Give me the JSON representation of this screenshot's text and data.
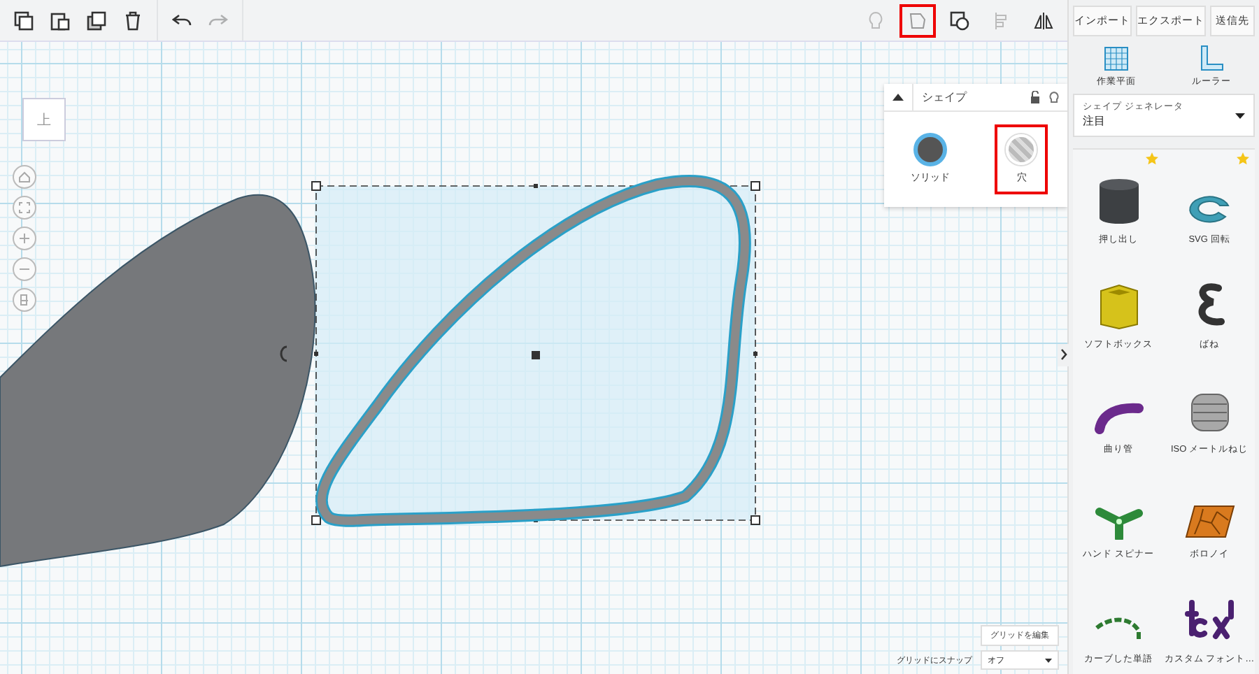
{
  "toolbar": {
    "left_tools": [
      {
        "kind": "copy"
      },
      {
        "kind": "paste"
      },
      {
        "kind": "duplicate"
      },
      {
        "kind": "delete"
      },
      {
        "kind": "undo",
        "disabled": false
      },
      {
        "kind": "redo",
        "disabled": true
      }
    ],
    "right_tools": [
      {
        "kind": "bulb",
        "highlighted": false
      },
      {
        "kind": "shape",
        "highlighted": true
      },
      {
        "kind": "group",
        "highlighted": false
      },
      {
        "kind": "align",
        "highlighted": false
      },
      {
        "kind": "mirror",
        "highlighted": false
      }
    ]
  },
  "view_cube": {
    "label": "上"
  },
  "shape_panel": {
    "title": "シェイプ",
    "options": [
      {
        "kind": "solid",
        "label": "ソリッド",
        "selected": true,
        "highlighted": false
      },
      {
        "kind": "hole",
        "label": "穴",
        "selected": false,
        "highlighted": true
      }
    ]
  },
  "header_buttons": [
    "インポート",
    "エクスポート",
    "送信先"
  ],
  "tools": [
    {
      "kind": "workplane",
      "label": "作業平面"
    },
    {
      "kind": "ruler",
      "label": "ルーラー"
    }
  ],
  "generator": {
    "label": "シェイプ ジェネレータ",
    "value": "注目"
  },
  "shapes": [
    {
      "kind": "extrude",
      "label": "押し出し",
      "starred": true
    },
    {
      "kind": "svg",
      "label": "SVG 回転",
      "starred": true
    },
    {
      "kind": "box",
      "label": "ソフトボックス",
      "starred": false
    },
    {
      "kind": "spring",
      "label": "ばね",
      "starred": false
    },
    {
      "kind": "pipe",
      "label": "曲り管",
      "starred": false
    },
    {
      "kind": "screw",
      "label": "ISO メートルねじ",
      "starred": false
    },
    {
      "kind": "spinner",
      "label": "ハンド スピナー",
      "starred": false
    },
    {
      "kind": "voronoi",
      "label": "ボロノイ",
      "starred": false
    },
    {
      "kind": "curved",
      "label": "カーブした単語",
      "starred": false
    },
    {
      "kind": "font",
      "label": "カスタム フォント…",
      "starred": false
    }
  ],
  "grid": {
    "edit_label": "グリッドを編集",
    "snap_label": "グリッドにスナップ",
    "snap_value": "オフ"
  }
}
